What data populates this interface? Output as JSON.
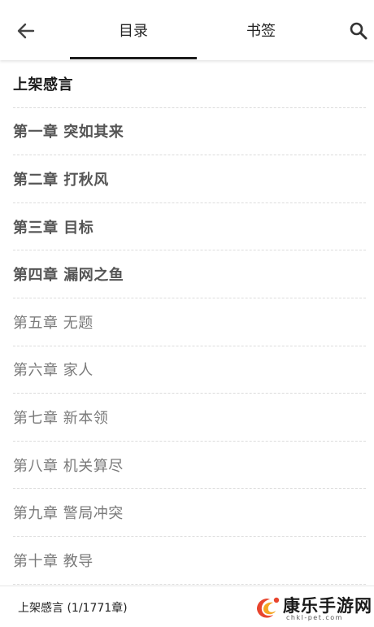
{
  "header": {
    "tabs": [
      {
        "label": "目录",
        "active": true
      },
      {
        "label": "书签",
        "active": false
      }
    ],
    "back_icon": "arrow-left-icon",
    "search_icon": "search-icon"
  },
  "chapters": [
    {
      "title": "上架感言",
      "style": "intro"
    },
    {
      "title": "第一章  突如其来",
      "style": "cached"
    },
    {
      "title": "第二章  打秋风",
      "style": "cached"
    },
    {
      "title": "第三章  目标",
      "style": "cached"
    },
    {
      "title": "第四章   漏网之鱼",
      "style": "cached"
    },
    {
      "title": "第五章  无题",
      "style": "plain"
    },
    {
      "title": "第六章   家人",
      "style": "plain"
    },
    {
      "title": "第七章  新本领",
      "style": "plain"
    },
    {
      "title": "第八章   机关算尽",
      "style": "plain"
    },
    {
      "title": "第九章   警局冲突",
      "style": "plain"
    },
    {
      "title": "第十章  教导",
      "style": "plain"
    }
  ],
  "footer": {
    "current": "上架感言 (1/1771章)"
  },
  "watermark": {
    "name": "康乐手游网",
    "url": "chkl-pet.com"
  },
  "colors": {
    "accent": "#1c1c1c",
    "cached_text": "#555555",
    "plain_text": "#7a7a7a",
    "divider": "#dcdcdc",
    "logo_red": "#e8452e",
    "logo_orange": "#f5a623"
  }
}
